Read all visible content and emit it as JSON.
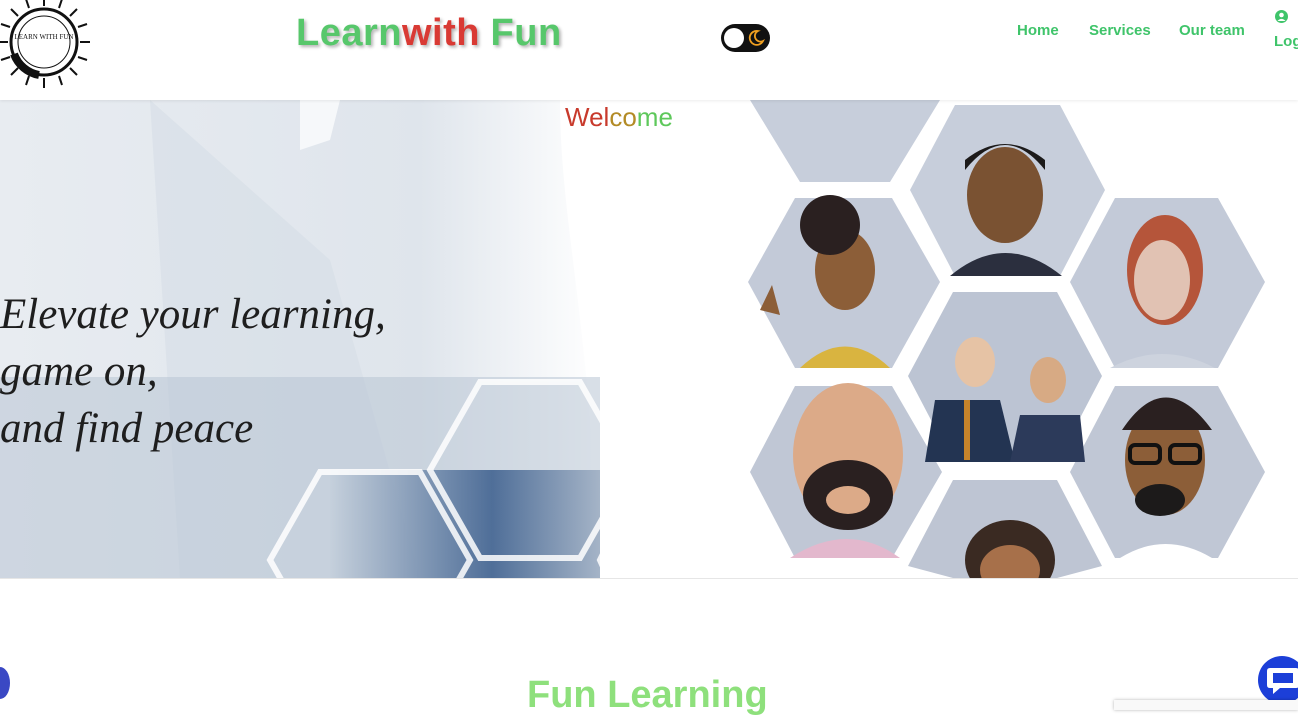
{
  "header": {
    "brand_part1": "Learn",
    "brand_part2": "with",
    "brand_part3": "Fun",
    "brand_color_primary": "#57c76b",
    "brand_color_secondary": "#d93a34",
    "nav": {
      "home": "Home",
      "services": "Services",
      "team": "Our team",
      "login": "Log"
    },
    "nav_color": "#3fc46a",
    "theme_toggle_icon": "moon-icon",
    "user_icon": "user-circle-icon"
  },
  "logo": {
    "icon": "sunburst-logo-icon",
    "text": "LEARN WITH FUN"
  },
  "hero": {
    "welcome": {
      "part1": "Wel",
      "part2": "co",
      "part3": "me"
    },
    "tagline": {
      "line1": "Elevate your learning,",
      "line2": "game on,",
      "line3": "and find peace"
    },
    "art_icons": [
      "hexagon-pattern",
      "people-portraits-icon"
    ]
  },
  "section": {
    "title": "Fun Learning",
    "title_color": "#8ee07c"
  },
  "widgets": {
    "chat_icon": "chat-bubble-icon",
    "side_button_color": "#3a48c4",
    "chat_button_color": "#1c3fd8"
  }
}
